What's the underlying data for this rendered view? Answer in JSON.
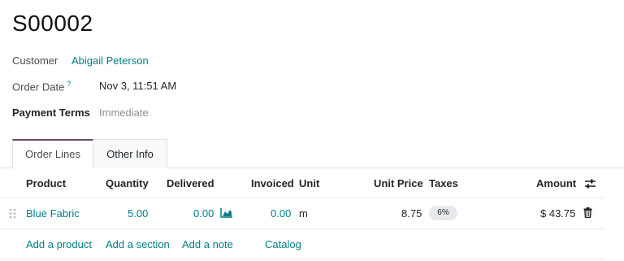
{
  "record": {
    "title": "S00002"
  },
  "fields": {
    "customer_label": "Customer",
    "customer_value": "Abigail Peterson",
    "order_date_label": "Order Date",
    "order_date_help": "?",
    "order_date_value": "Nov 3, 11:51 AM",
    "payment_terms_label": "Payment Terms",
    "payment_terms_placeholder": "Immediate"
  },
  "tabs": [
    {
      "label": "Order Lines",
      "active": true
    },
    {
      "label": "Other Info",
      "active": false
    }
  ],
  "table": {
    "headers": {
      "product": "Product",
      "quantity": "Quantity",
      "delivered": "Delivered",
      "invoiced": "Invoiced",
      "unit": "Unit",
      "unit_price": "Unit Price",
      "taxes": "Taxes",
      "amount": "Amount"
    },
    "rows": [
      {
        "product": "Blue Fabric",
        "quantity": "5.00",
        "delivered": "0.00",
        "invoiced": "0.00",
        "unit": "m",
        "unit_price": "8.75",
        "taxes": "6%",
        "amount": "$ 43.75"
      }
    ],
    "actions": {
      "add_product": "Add a product",
      "add_section": "Add a section",
      "add_note": "Add a note",
      "catalog": "Catalog"
    }
  },
  "icons": {
    "drag_handle": "drag-handle-icon",
    "forecast": "area-chart-icon",
    "delete": "trash-icon",
    "optional_columns": "sliders-icon"
  },
  "colors": {
    "link": "#017e84",
    "active_tab_border": "#714b67",
    "muted": "#8f8f8f"
  }
}
